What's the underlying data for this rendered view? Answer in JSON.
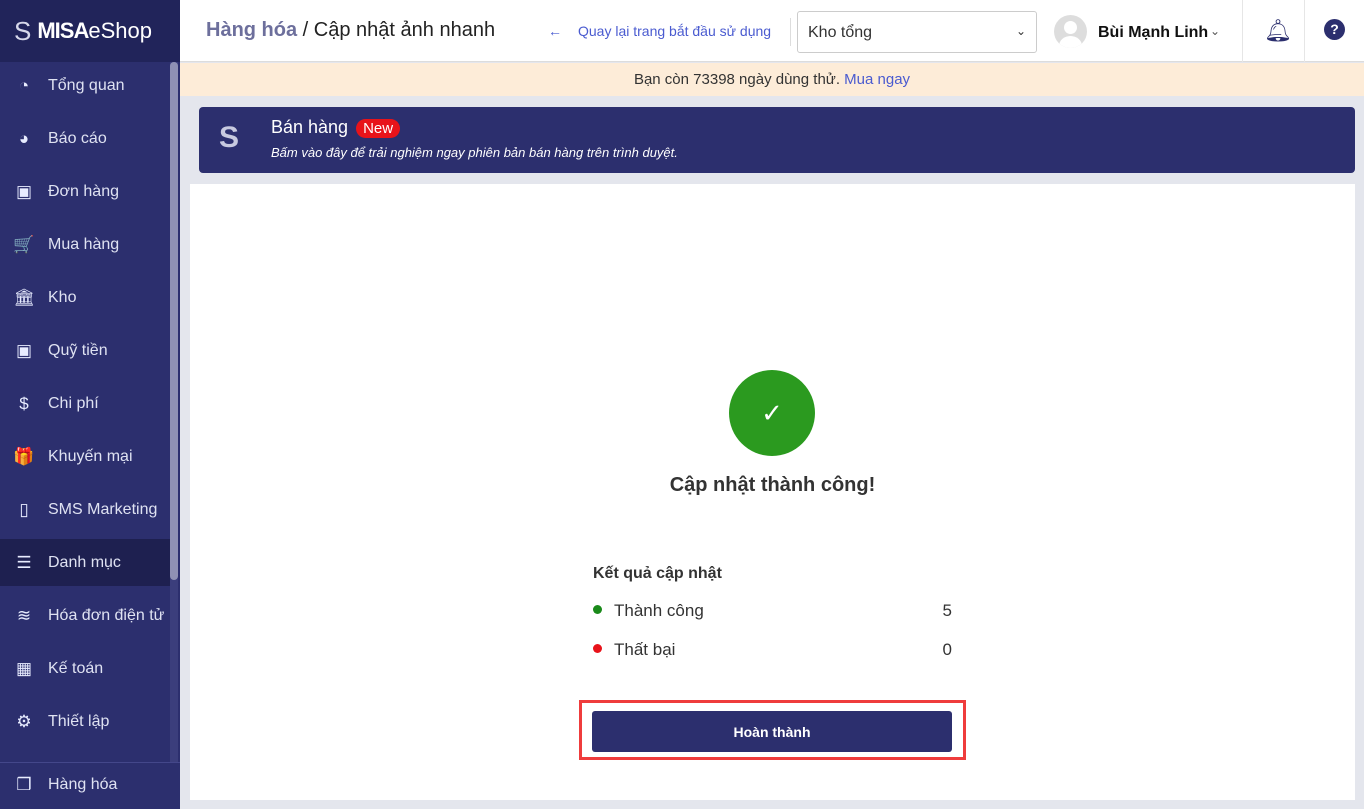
{
  "brand": {
    "name_bold": "MISA",
    "name_rest": "eShop"
  },
  "sidebar": {
    "items": [
      {
        "label": "Tổng quan",
        "icon": "dashboard-icon",
        "glyph": "◔"
      },
      {
        "label": "Báo cáo",
        "icon": "pie-chart-icon",
        "glyph": "◕"
      },
      {
        "label": "Đơn hàng",
        "icon": "truck-icon",
        "glyph": "▣"
      },
      {
        "label": "Mua hàng",
        "icon": "cart-icon",
        "glyph": "🛒"
      },
      {
        "label": "Kho",
        "icon": "warehouse-icon",
        "glyph": "🏛"
      },
      {
        "label": "Quỹ tiền",
        "icon": "safe-icon",
        "glyph": "▣"
      },
      {
        "label": "Chi phí",
        "icon": "money-bag-icon",
        "glyph": "$"
      },
      {
        "label": "Khuyến mại",
        "icon": "gift-icon",
        "glyph": "🎁"
      },
      {
        "label": "SMS Marketing",
        "icon": "phone-icon",
        "glyph": "▯"
      },
      {
        "label": "Danh mục",
        "icon": "list-icon",
        "glyph": "☰"
      },
      {
        "label": "Hóa đơn điện tử",
        "icon": "invoice-icon",
        "glyph": "≋"
      },
      {
        "label": "Kế toán",
        "icon": "calculator-icon",
        "glyph": "▦"
      },
      {
        "label": "Thiết lập",
        "icon": "gear-icon",
        "glyph": "⚙"
      }
    ],
    "bottom": {
      "label": "Hàng hóa",
      "icon": "boxes-icon",
      "glyph": "❒"
    }
  },
  "header": {
    "crumb_parent": "Hàng hóa",
    "crumb_sep": " / ",
    "crumb_current": "Cập nhật ảnh nhanh",
    "back_arrow": "←",
    "back_label": "Quay lại trang bắt đầu sử dụng",
    "store": "Kho tổng",
    "user": "Bùi Mạnh Linh",
    "help": "?"
  },
  "trial": {
    "text": "Bạn còn 73398 ngày dùng thử. ",
    "link": "Mua ngay"
  },
  "promo": {
    "title": "Bán hàng",
    "badge": "New",
    "subtitle": "Bấm vào đây để trải nghiệm ngay phiên bản bán hàng trên trình duyệt."
  },
  "result": {
    "check": "✓",
    "title": "Cập nhật thành công!",
    "section": "Kết quả cập nhật",
    "rows": [
      {
        "label": "Thành công",
        "value": "5",
        "color": "#1a8a1a"
      },
      {
        "label": "Thất bại",
        "value": "0",
        "color": "#e8131a"
      }
    ],
    "done": "Hoàn thành"
  }
}
